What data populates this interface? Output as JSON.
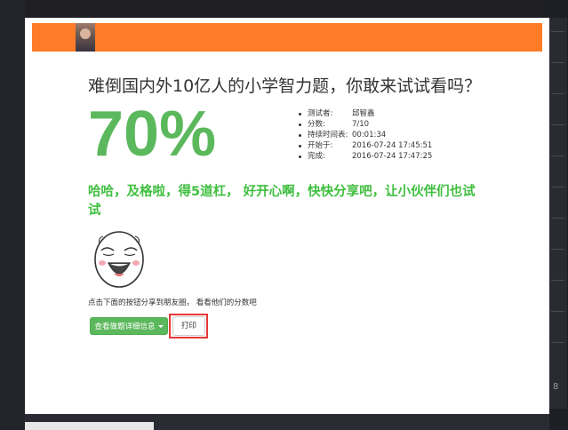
{
  "quiz": {
    "title": "难倒国内外10亿人的小学智力题，你敢来试试看吗？",
    "score": "70%",
    "message": "哈哈，及格啦，得5道杠， 好开心啊，快快分享吧，让小伙伴们也试试",
    "info": [
      {
        "label": "测试者:",
        "value": "邱智鑫"
      },
      {
        "label": "分数:",
        "value": "7/10"
      },
      {
        "label": "持续时间表:",
        "value": "00:01:34"
      },
      {
        "label": "开始于:",
        "value": "2016-07-24 17:45:51"
      },
      {
        "label": "完成:",
        "value": "2016-07-24 17:47:25"
      }
    ],
    "share_hint": "点击下面的按钮分享到朋友圈， 看看他们的分数吧",
    "detail_button": "查看做题详细信息",
    "print_button": "打印"
  },
  "page_marker": "8",
  "colors": {
    "banner": "#ff7b28",
    "score": "#5cb85c",
    "message": "#3fbf3f",
    "highlight": "#e53935"
  }
}
